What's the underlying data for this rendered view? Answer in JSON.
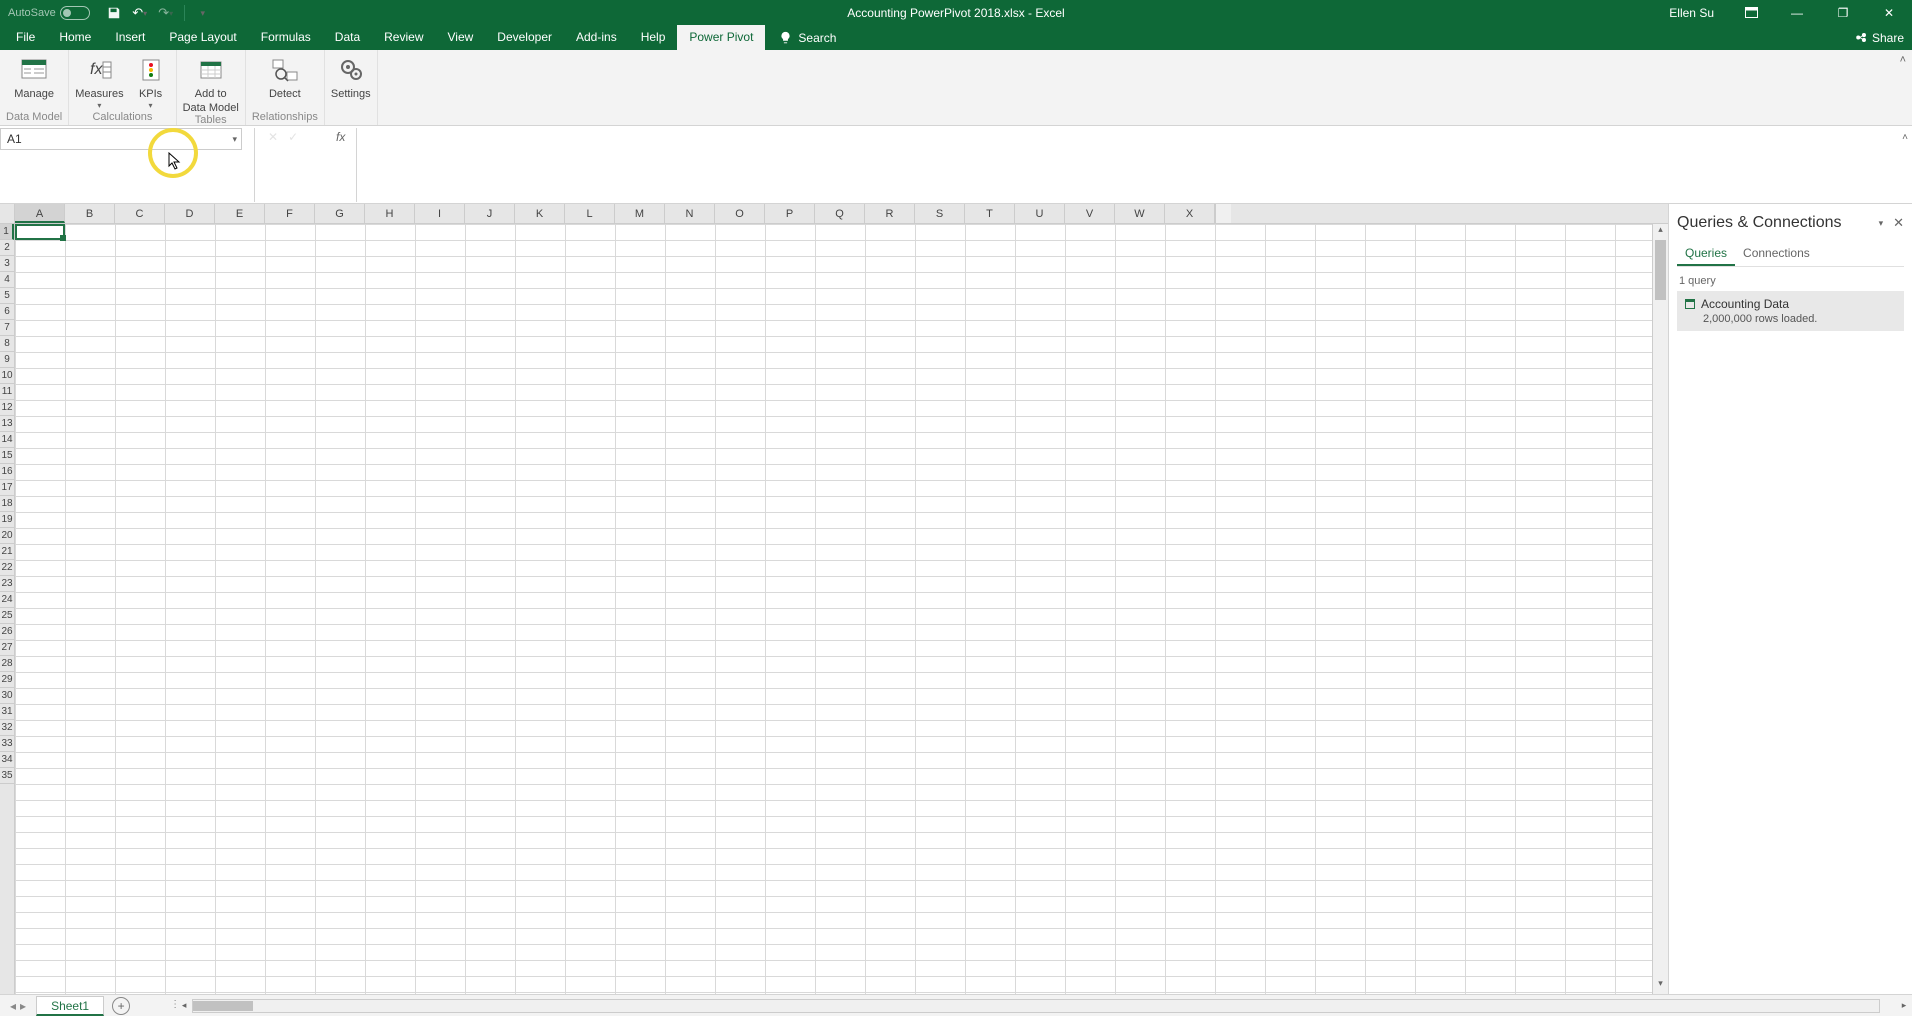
{
  "titleBar": {
    "autoSaveLabel": "AutoSave",
    "autoSaveState": "Off",
    "documentTitle": "Accounting PowerPivot 2018.xlsx - Excel",
    "userName": "Ellen Su"
  },
  "ribbonTabs": {
    "file": "File",
    "home": "Home",
    "insert": "Insert",
    "pageLayout": "Page Layout",
    "formulas": "Formulas",
    "data": "Data",
    "review": "Review",
    "view": "View",
    "developer": "Developer",
    "addins": "Add-ins",
    "help": "Help",
    "powerPivot": "Power Pivot",
    "search": "Search",
    "share": "Share"
  },
  "ribbon": {
    "manage": {
      "label": "Manage",
      "group": "Data Model"
    },
    "measures": {
      "label": "Measures"
    },
    "kpis": {
      "label": "KPIs",
      "group": "Calculations"
    },
    "addTo": {
      "line1": "Add to",
      "line2": "Data Model",
      "group": "Tables"
    },
    "detect": {
      "label": "Detect",
      "group": "Relationships"
    },
    "settings": {
      "label": "Settings"
    }
  },
  "nameBox": "A1",
  "columns": [
    "A",
    "B",
    "C",
    "D",
    "E",
    "F",
    "G",
    "H",
    "I",
    "J",
    "K",
    "L",
    "M",
    "N",
    "O",
    "P",
    "Q",
    "R",
    "S",
    "T",
    "U",
    "V",
    "W",
    "X"
  ],
  "rows": [
    "1",
    "2",
    "3",
    "4",
    "5",
    "6",
    "7",
    "8",
    "9",
    "10",
    "11",
    "12",
    "13",
    "14",
    "15",
    "16",
    "17",
    "18",
    "19",
    "20",
    "21",
    "22",
    "23",
    "24",
    "25",
    "26",
    "27",
    "28",
    "29",
    "30",
    "31",
    "32",
    "33",
    "34",
    "35"
  ],
  "queriesPane": {
    "title": "Queries & Connections",
    "tabQueries": "Queries",
    "tabConnections": "Connections",
    "count": "1 query",
    "item": {
      "name": "Accounting Data",
      "status": "2,000,000 rows loaded."
    }
  },
  "sheetTabs": {
    "sheet1": "Sheet1"
  }
}
